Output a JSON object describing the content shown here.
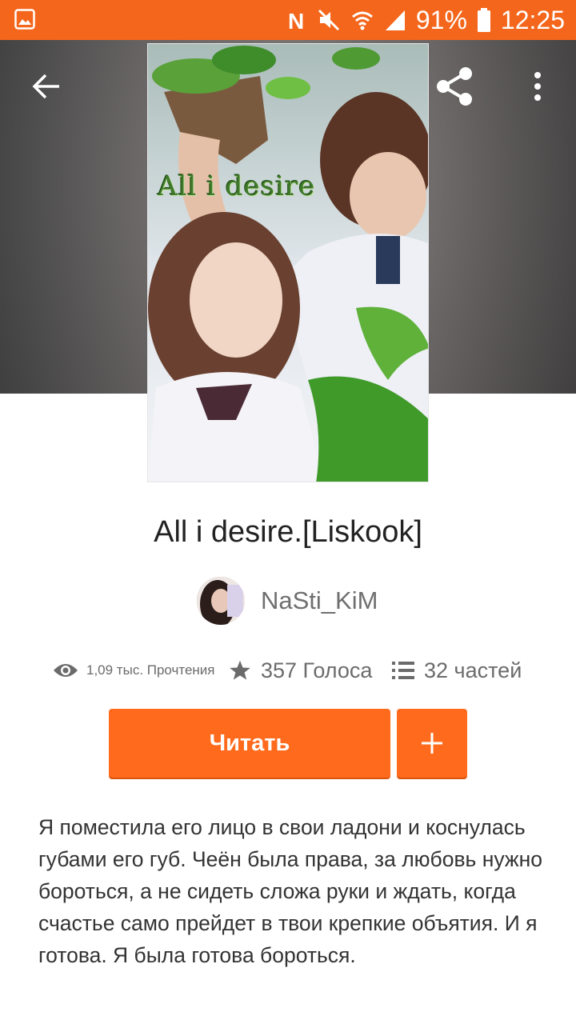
{
  "status_bar": {
    "battery": "91%",
    "time": "12:25",
    "icons": [
      "gallery-icon",
      "nfc-icon",
      "mute-icon",
      "wifi-icon",
      "signal-icon",
      "battery-icon"
    ]
  },
  "header": {
    "icons": [
      "back-arrow-icon",
      "share-icon",
      "more-vert-icon"
    ]
  },
  "cover": {
    "title_art_text": "All i desire"
  },
  "book": {
    "title": "All i desire.[Liskook]",
    "author": "NaSti_KiM"
  },
  "stats": {
    "reads": "1,09 тыс. Прочтения",
    "votes": "357 Голоса",
    "parts": "32 частей",
    "icons": [
      "eye-icon",
      "star-icon",
      "list-icon"
    ]
  },
  "actions": {
    "read_label": "Читать",
    "add_icon": "plus-icon"
  },
  "description": "Я поместила его лицо в свои ладони и коснулась губами его губ. Чеён была права, за любовь нужно бороться, а не сидеть сложа руки и ждать, когда счастье само прейдет в твои крепкие объятия. И я готова. Я была готова бороться.",
  "colors": {
    "accent": "#ff6a1c",
    "status_bar": "#f4661b",
    "text_primary": "#222222",
    "text_secondary": "#6b6b6b"
  }
}
